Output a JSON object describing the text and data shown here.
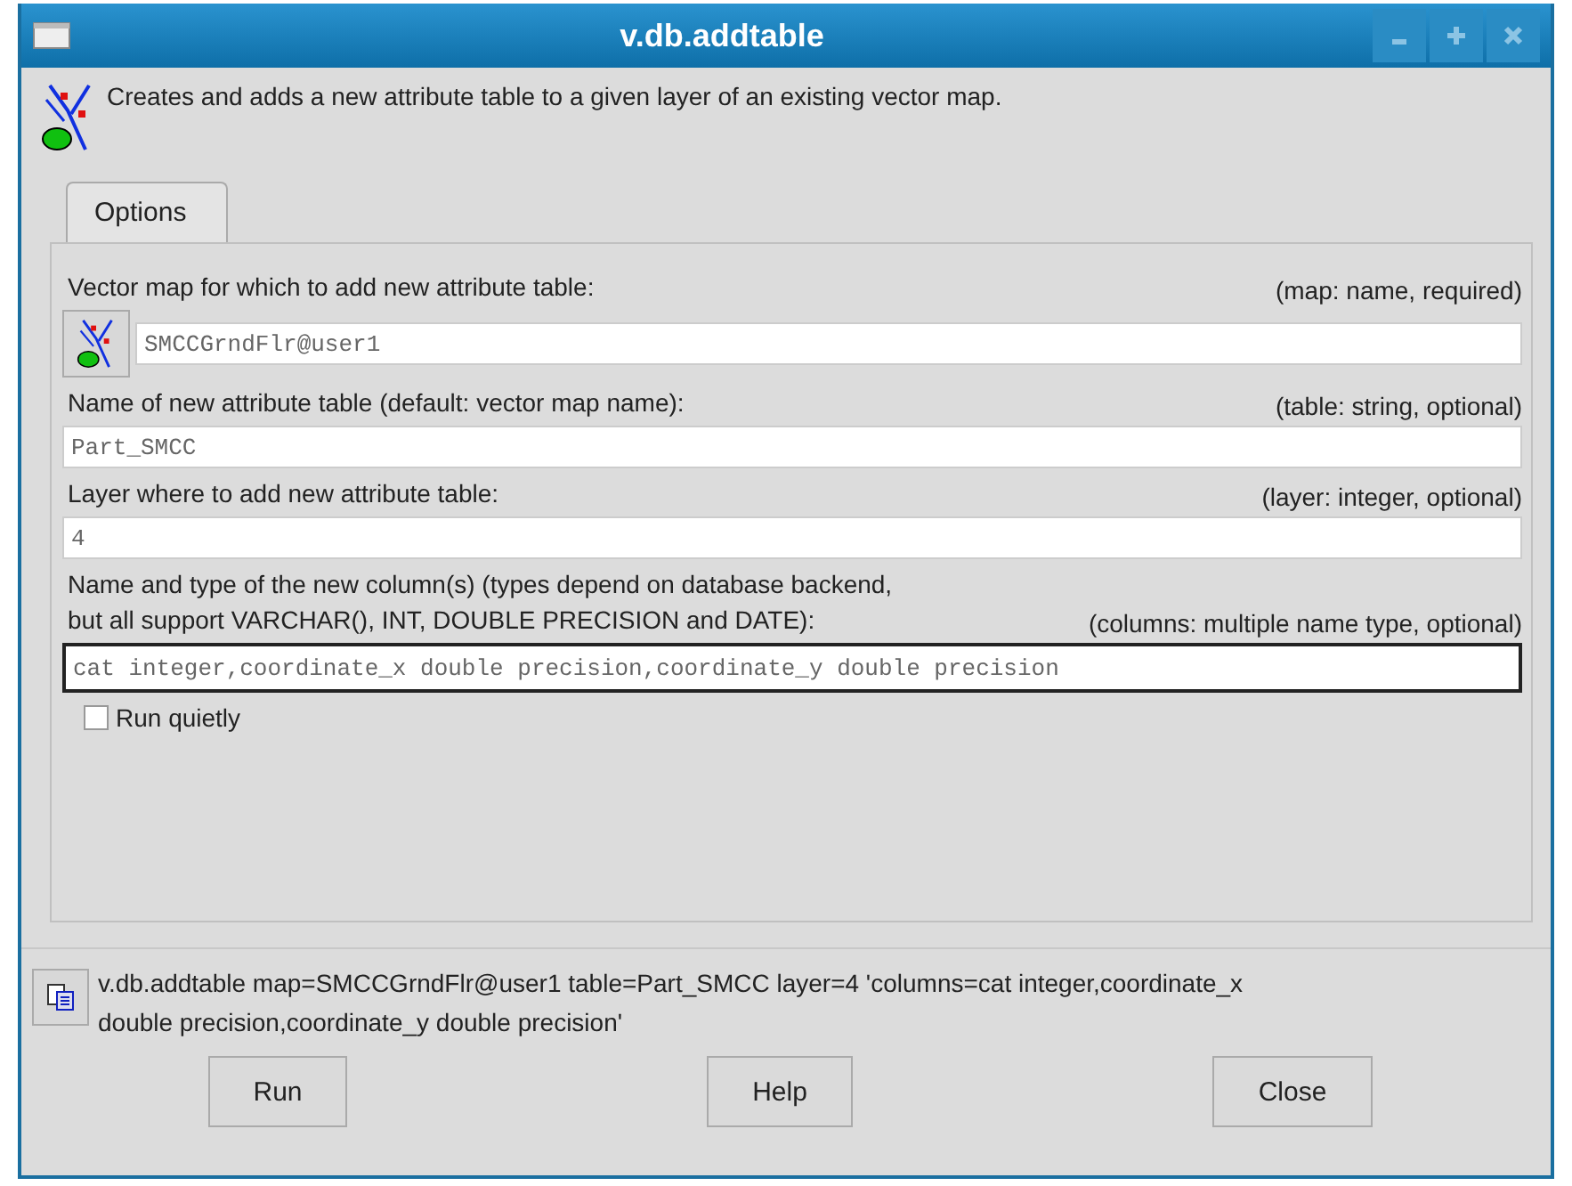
{
  "window": {
    "title": "v.db.addtable"
  },
  "description": "Creates and adds a new attribute table to a given layer of an existing vector map.",
  "tabs": [
    {
      "label": "Options",
      "selected": true
    }
  ],
  "options": [
    {
      "kind": "map",
      "label": "Vector map for which to add new attribute table:",
      "hint": "(map: name, required)",
      "value": "SMCCGrndFlr@user1",
      "focused": false
    },
    {
      "kind": "text",
      "label": "Name of new attribute table (default: vector map name):",
      "hint": "(table: string, optional)",
      "value": "Part_SMCC",
      "focused": false
    },
    {
      "kind": "text",
      "label": "Layer where to add new attribute table:",
      "hint": "(layer: integer, optional)",
      "value": "4",
      "focused": false
    },
    {
      "kind": "text",
      "label": "Name and type of the new column(s) (types depend on database backend, but all support VARCHAR(), INT, DOUBLE PRECISION and DATE):",
      "hint": "(columns: multiple name type, optional)",
      "value": "cat integer,coordinate_x double precision,coordinate_y double precision",
      "focused": true
    }
  ],
  "flags": [
    {
      "label": "Run quietly",
      "checked": false
    }
  ],
  "command": "v.db.addtable map=SMCCGrndFlr@user1 table=Part_SMCC layer=4 'columns=cat integer,coordinate_x double precision,coordinate_y double precision'",
  "buttons": [
    "Run",
    "Help",
    "Close"
  ]
}
